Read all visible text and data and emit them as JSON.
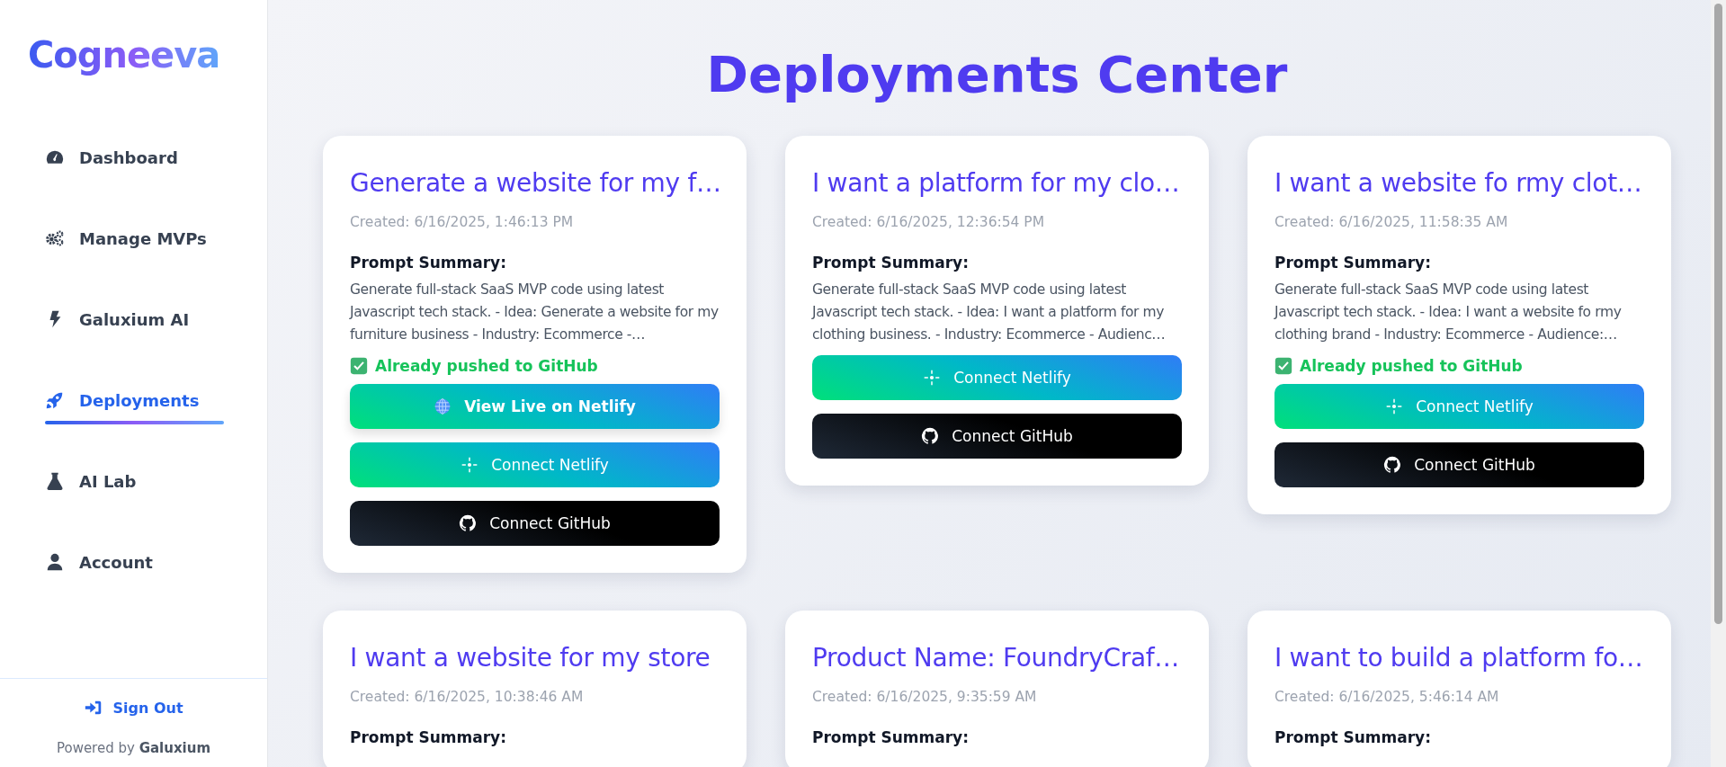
{
  "sidebar": {
    "logo": "Cogneeva",
    "items": [
      {
        "label": "Dashboard",
        "selected": false
      },
      {
        "label": "Manage MVPs",
        "selected": false
      },
      {
        "label": "Galuxium AI",
        "selected": false
      },
      {
        "label": "Deployments",
        "selected": true
      },
      {
        "label": "AI Lab",
        "selected": false
      },
      {
        "label": "Account",
        "selected": false
      }
    ],
    "sign_out": "Sign Out",
    "powered_by": "Powered by **Galuxium**"
  },
  "title": "Deployments Center",
  "cards": [
    {
      "title": "Generate a website for my f…",
      "created": "Created: 6/16/2025, 1:46:13 PM",
      "summary_label": "Prompt Summary:",
      "summary": "Generate full-stack SaaS MVP code using latest Javascript tech stack. - Idea: Generate a website for my furniture business - Industry: Ecommerce -…",
      "status": "Already pushed to GitHub",
      "buttons": [
        {
          "kind": "live",
          "label": "View Live on Netlify"
        },
        {
          "kind": "netlify",
          "label": "Connect Netlify"
        },
        {
          "kind": "github",
          "label": "Connect GitHub"
        }
      ]
    },
    {
      "title": "I want a platform for my clo…",
      "created": "Created: 6/16/2025, 12:36:54 PM",
      "summary_label": "Prompt Summary:",
      "summary": "Generate full-stack SaaS MVP code using latest Javascript tech stack. - Idea: I want a platform for my clothing business. - Industry: Ecommerce - Audienc…",
      "buttons": [
        {
          "kind": "netlify",
          "label": "Connect Netlify"
        },
        {
          "kind": "github",
          "label": "Connect GitHub"
        }
      ]
    },
    {
      "title": "I want a website fo rmy clot…",
      "created": "Created: 6/16/2025, 11:58:35 AM",
      "summary_label": "Prompt Summary:",
      "summary": "Generate full-stack SaaS MVP code using latest Javascript tech stack. - Idea: I want a website fo rmy clothing brand - Industry: Ecommerce - Audience:…",
      "status": "Already pushed to GitHub",
      "buttons": [
        {
          "kind": "netlify",
          "label": "Connect Netlify"
        },
        {
          "kind": "github",
          "label": "Connect GitHub"
        }
      ]
    },
    {
      "title": "I want a website for my store",
      "created": "Created: 6/16/2025, 10:38:46 AM",
      "summary_label": "Prompt Summary:"
    },
    {
      "title": "Product Name: FoundryCraf…",
      "created": "Created: 6/16/2025, 9:35:59 AM",
      "summary_label": "Prompt Summary:"
    },
    {
      "title": "I want to build a platform fo…",
      "created": "Created: 6/16/2025, 5:46:14 AM",
      "summary_label": "Prompt Summary:"
    }
  ]
}
